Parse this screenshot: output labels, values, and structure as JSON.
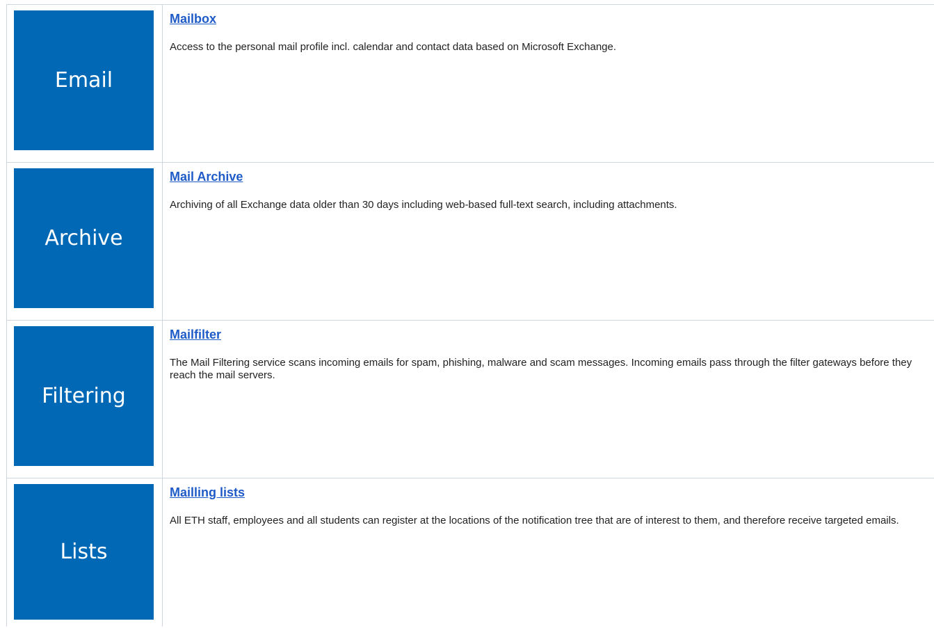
{
  "services": [
    {
      "tile_label": "Email",
      "title": "Mailbox",
      "description": "Access to the personal mail profile incl. calendar and contact data based on Microsoft Exchange."
    },
    {
      "tile_label": "Archive",
      "title": "Mail Archive",
      "description": "Archiving of all Exchange data older than 30 days including web-based full-text search, including attachments."
    },
    {
      "tile_label": "Filtering",
      "title": "Mailfilter",
      "description": "The Mail Filtering service scans incoming emails for spam, phishing, malware and scam messages. Incoming emails pass through the filter gateways before they reach the mail servers."
    },
    {
      "tile_label": "Lists",
      "title": "Mailling lists",
      "description": "All ETH staff, employees and all students can register at the locations of the notification tree that are of interest to them, and therefore receive targeted emails."
    }
  ],
  "colors": {
    "tile_background": "#0068b4",
    "link": "#1f5bc7",
    "border": "#cfd6de"
  }
}
